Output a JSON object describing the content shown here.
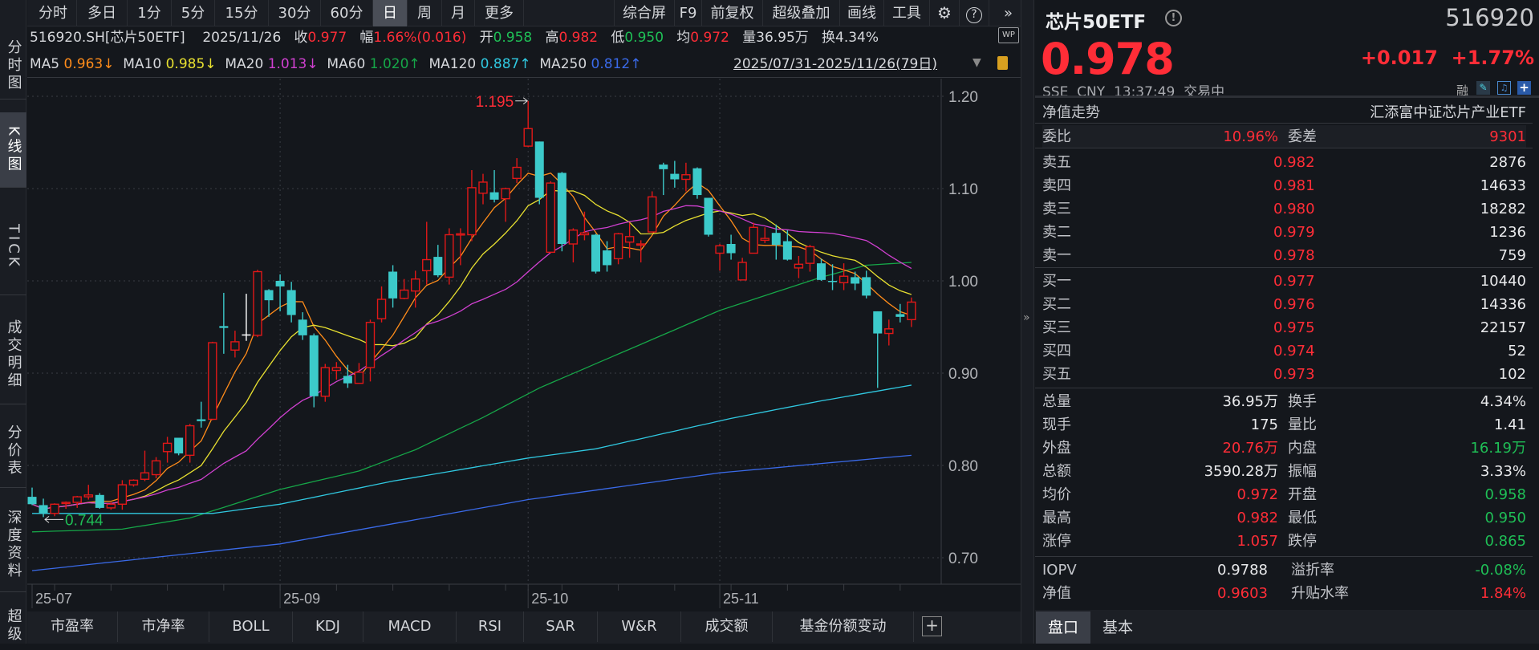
{
  "toolbar": {
    "periods": [
      "分时",
      "多日",
      "1分",
      "5分",
      "15分",
      "30分",
      "60分",
      "日",
      "周",
      "月",
      "更多"
    ],
    "active_period": "日",
    "tools": [
      "综合屏",
      "F9",
      "前复权",
      "超级叠加",
      "画线",
      "工具"
    ]
  },
  "left_tabs": [
    "分时图",
    "K线图",
    "TICK",
    "成交明细",
    "分价表",
    "深度资料",
    "超级"
  ],
  "info": {
    "symbol": "516920.SH[芯片50ETF]",
    "date": "2025/11/26",
    "close_label": "收",
    "close": "0.977",
    "range_label": "幅",
    "range": "1.66%(0.016)",
    "open_label": "开",
    "open": "0.958",
    "high_label": "高",
    "high": "0.982",
    "low_label": "低",
    "low": "0.950",
    "avg_label": "均",
    "avg": "0.972",
    "vol_label": "量",
    "vol": "36.95万",
    "turn_label": "换",
    "turn": "4.34%",
    "ma": [
      {
        "label": "MA5",
        "value": "0.963↓",
        "color": "#ff8c1a"
      },
      {
        "label": "MA10",
        "value": "0.985↓",
        "color": "#e8e030"
      },
      {
        "label": "MA20",
        "value": "1.013↓",
        "color": "#d040d0"
      },
      {
        "label": "MA60",
        "value": "1.020↑",
        "color": "#16a648"
      },
      {
        "label": "MA120",
        "value": "0.887↑",
        "color": "#30c8e0"
      },
      {
        "label": "MA250",
        "value": "0.812↑",
        "color": "#3a6ae8"
      }
    ],
    "date_range": "2025/07/31-2025/11/26(79日)"
  },
  "chart_data": {
    "type": "candlestick",
    "ylim": [
      0.68,
      1.22
    ],
    "y_ticks": [
      "1.20",
      "1.10",
      "1.00",
      "0.90",
      "0.80",
      "0.70"
    ],
    "x_ticks": [
      {
        "label": "25-07",
        "index": 0
      },
      {
        "label": "25-09",
        "index": 22
      },
      {
        "label": "25-10",
        "index": 44
      },
      {
        "label": "25-11",
        "index": 61
      }
    ],
    "annotations": [
      {
        "label": "1.195",
        "index": 44,
        "price": 1.195,
        "kind": "high"
      },
      {
        "label": "0.744",
        "index": 1,
        "price": 0.744,
        "kind": "low"
      }
    ],
    "ohlc": [
      [
        0.766,
        0.776,
        0.757,
        0.758
      ],
      [
        0.757,
        0.764,
        0.744,
        0.748
      ],
      [
        0.748,
        0.759,
        0.745,
        0.758
      ],
      [
        0.759,
        0.761,
        0.753,
        0.76
      ],
      [
        0.76,
        0.767,
        0.754,
        0.766
      ],
      [
        0.766,
        0.779,
        0.763,
        0.768
      ],
      [
        0.768,
        0.77,
        0.753,
        0.754
      ],
      [
        0.754,
        0.76,
        0.752,
        0.758
      ],
      [
        0.758,
        0.784,
        0.752,
        0.779
      ],
      [
        0.779,
        0.785,
        0.777,
        0.784
      ],
      [
        0.785,
        0.816,
        0.783,
        0.792
      ],
      [
        0.79,
        0.809,
        0.786,
        0.805
      ],
      [
        0.815,
        0.831,
        0.803,
        0.824
      ],
      [
        0.83,
        0.83,
        0.811,
        0.813
      ],
      [
        0.811,
        0.845,
        0.803,
        0.843
      ],
      [
        0.85,
        0.869,
        0.841,
        0.848
      ],
      [
        0.85,
        0.934,
        0.849,
        0.933
      ],
      [
        0.951,
        0.987,
        0.921,
        0.949
      ],
      [
        0.925,
        0.946,
        0.917,
        0.934
      ],
      [
        0.942,
        0.986,
        0.935,
        0.942
      ],
      [
        0.941,
        1.012,
        0.939,
        1.01
      ],
      [
        0.99,
        0.991,
        0.961,
        0.979
      ],
      [
        1.0,
        1.007,
        0.967,
        0.994
      ],
      [
        0.99,
        0.999,
        0.955,
        0.963
      ],
      [
        0.958,
        0.966,
        0.936,
        0.941
      ],
      [
        0.941,
        0.943,
        0.863,
        0.875
      ],
      [
        0.875,
        0.91,
        0.869,
        0.906
      ],
      [
        0.903,
        0.912,
        0.893,
        0.906
      ],
      [
        0.897,
        0.909,
        0.884,
        0.889
      ],
      [
        0.889,
        0.911,
        0.889,
        0.901
      ],
      [
        0.906,
        0.958,
        0.891,
        0.955
      ],
      [
        0.959,
        0.994,
        0.955,
        0.98
      ],
      [
        1.01,
        1.017,
        0.971,
        0.981
      ],
      [
        0.981,
        1.002,
        0.98,
        0.99
      ],
      [
        0.989,
        1.011,
        0.971,
        1.002
      ],
      [
        1.011,
        1.064,
        0.996,
        1.023
      ],
      [
        1.026,
        1.039,
        1.004,
        1.006
      ],
      [
        1.004,
        1.057,
        0.996,
        1.05
      ],
      [
        1.05,
        1.057,
        1.017,
        1.051
      ],
      [
        1.05,
        1.12,
        1.043,
        1.101
      ],
      [
        1.095,
        1.116,
        1.083,
        1.107
      ],
      [
        1.096,
        1.12,
        1.085,
        1.088
      ],
      [
        1.089,
        1.101,
        1.064,
        1.1
      ],
      [
        1.111,
        1.133,
        1.106,
        1.123
      ],
      [
        1.146,
        1.195,
        1.145,
        1.165
      ],
      [
        1.151,
        1.151,
        1.083,
        1.09
      ],
      [
        1.031,
        1.108,
        1.03,
        1.106
      ],
      [
        1.117,
        1.118,
        1.032,
        1.04
      ],
      [
        1.04,
        1.057,
        1.02,
        1.055
      ],
      [
        1.05,
        1.075,
        1.044,
        1.052
      ],
      [
        1.05,
        1.051,
        1.008,
        1.01
      ],
      [
        1.033,
        1.043,
        1.01,
        1.017
      ],
      [
        1.024,
        1.052,
        1.018,
        1.051
      ],
      [
        1.042,
        1.063,
        1.025,
        1.048
      ],
      [
        1.039,
        1.044,
        1.02,
        1.04
      ],
      [
        1.053,
        1.097,
        1.052,
        1.091
      ],
      [
        1.126,
        1.128,
        1.093,
        1.121
      ],
      [
        1.116,
        1.13,
        1.101,
        1.11
      ],
      [
        1.11,
        1.128,
        1.097,
        1.115
      ],
      [
        1.122,
        1.123,
        1.089,
        1.093
      ],
      [
        1.09,
        1.09,
        1.048,
        1.05
      ],
      [
        1.03,
        1.04,
        1.011,
        1.038
      ],
      [
        1.04,
        1.05,
        1.023,
        1.03
      ],
      [
        1.001,
        1.025,
        1.001,
        1.02
      ],
      [
        1.03,
        1.063,
        1.03,
        1.058
      ],
      [
        1.044,
        1.058,
        1.041,
        1.046
      ],
      [
        1.052,
        1.061,
        1.023,
        1.039
      ],
      [
        1.043,
        1.055,
        1.022,
        1.023
      ],
      [
        1.014,
        1.027,
        1.003,
        1.018
      ],
      [
        1.019,
        1.039,
        1.01,
        1.037
      ],
      [
        1.019,
        1.024,
        1.0,
        1.001
      ],
      [
        1.0,
        1.018,
        0.99,
        0.999
      ],
      [
        0.998,
        1.019,
        0.99,
        1.005
      ],
      [
        1.004,
        1.01,
        0.99,
        0.997
      ],
      [
        1.004,
        1.011,
        0.981,
        0.984
      ],
      [
        0.967,
        0.967,
        0.884,
        0.943
      ],
      [
        0.943,
        0.958,
        0.93,
        0.948
      ],
      [
        0.964,
        0.975,
        0.955,
        0.961
      ],
      [
        0.958,
        0.982,
        0.95,
        0.977
      ]
    ],
    "ma_computed": [
      {
        "name": "MA5",
        "period": 5
      },
      {
        "name": "MA10",
        "period": 10
      },
      {
        "name": "MA20",
        "period": 20
      }
    ],
    "ma_sampled": [
      {
        "name": "MA60",
        "points": [
          [
            0,
            0.728
          ],
          [
            8,
            0.731
          ],
          [
            14,
            0.743
          ],
          [
            22,
            0.774
          ],
          [
            29,
            0.794
          ],
          [
            34,
            0.817
          ],
          [
            40,
            0.852
          ],
          [
            45,
            0.884
          ],
          [
            61,
            0.968
          ],
          [
            70,
            1.004
          ],
          [
            74,
            1.017
          ],
          [
            78,
            1.02
          ]
        ]
      },
      {
        "name": "MA120",
        "points": [
          [
            0,
            0.748
          ],
          [
            16,
            0.748
          ],
          [
            22,
            0.758
          ],
          [
            32,
            0.783
          ],
          [
            44,
            0.808
          ],
          [
            50,
            0.818
          ],
          [
            62,
            0.851
          ],
          [
            70,
            0.87
          ],
          [
            78,
            0.887
          ]
        ]
      },
      {
        "name": "MA250",
        "points": [
          [
            0,
            0.686
          ],
          [
            22,
            0.715
          ],
          [
            44,
            0.763
          ],
          [
            61,
            0.792
          ],
          [
            78,
            0.811
          ]
        ]
      }
    ],
    "colors": {
      "up": "#e01818",
      "down": "#3ccaca",
      "doji": "#ffffff"
    }
  },
  "indicator_tabs": [
    "市盈率",
    "市净率",
    "BOLL",
    "KDJ",
    "MACD",
    "RSI",
    "SAR",
    "W&R",
    "成交额",
    "基金份额变动"
  ],
  "add_tab": "+",
  "quote": {
    "name": "芯片50ETF",
    "code": "516920",
    "price": "0.978",
    "change": "+0.017",
    "change_pct": "+1.77%",
    "exchange": "SSE",
    "currency": "CNY",
    "time": "13:37:49",
    "status": "交易中",
    "margin_tag": "融",
    "nav_trend": "净值走势",
    "fund_name": "汇添富中证芯片产业ETF",
    "weibi_label": "委比",
    "weibi": "10.96%",
    "weicha_label": "委差",
    "weicha": "9301",
    "asks": [
      {
        "label": "卖五",
        "price": "0.982",
        "vol": "2876"
      },
      {
        "label": "卖四",
        "price": "0.981",
        "vol": "14633"
      },
      {
        "label": "卖三",
        "price": "0.980",
        "vol": "18282"
      },
      {
        "label": "卖二",
        "price": "0.979",
        "vol": "1236"
      },
      {
        "label": "卖一",
        "price": "0.978",
        "vol": "759"
      }
    ],
    "bids": [
      {
        "label": "买一",
        "price": "0.977",
        "vol": "10440"
      },
      {
        "label": "买二",
        "price": "0.976",
        "vol": "14336"
      },
      {
        "label": "买三",
        "price": "0.975",
        "vol": "22157"
      },
      {
        "label": "买四",
        "price": "0.974",
        "vol": "52"
      },
      {
        "label": "买五",
        "price": "0.973",
        "vol": "102"
      }
    ],
    "stats": [
      {
        "l1": "总量",
        "v1": "36.95万",
        "c1": "w",
        "l2": "换手",
        "v2": "4.34%",
        "c2": "w"
      },
      {
        "l1": "现手",
        "v1": "175",
        "c1": "w",
        "l2": "量比",
        "v2": "1.41",
        "c2": "w"
      },
      {
        "l1": "外盘",
        "v1": "20.76万",
        "c1": "red",
        "l2": "内盘",
        "v2": "16.19万",
        "c2": "green"
      },
      {
        "l1": "总额",
        "v1": "3590.28万",
        "c1": "w",
        "l2": "振幅",
        "v2": "3.33%",
        "c2": "w"
      },
      {
        "l1": "均价",
        "v1": "0.972",
        "c1": "red",
        "l2": "开盘",
        "v2": "0.958",
        "c2": "green"
      },
      {
        "l1": "最高",
        "v1": "0.982",
        "c1": "red",
        "l2": "最低",
        "v2": "0.950",
        "c2": "green"
      },
      {
        "l1": "涨停",
        "v1": "1.057",
        "c1": "red",
        "l2": "跌停",
        "v2": "0.865",
        "c2": "green"
      }
    ],
    "etf_stats": [
      {
        "l1": "IOPV",
        "v1": "0.9788",
        "c1": "w",
        "l2": "溢折率",
        "v2": "-0.08%",
        "c2": "green"
      },
      {
        "l1": "净值",
        "v1": "0.9603",
        "c1": "red",
        "l2": "升贴水率",
        "v2": "1.84%",
        "c2": "red"
      }
    ],
    "tabs": [
      "盘口",
      "基本"
    ],
    "active_tab": "盘口"
  }
}
